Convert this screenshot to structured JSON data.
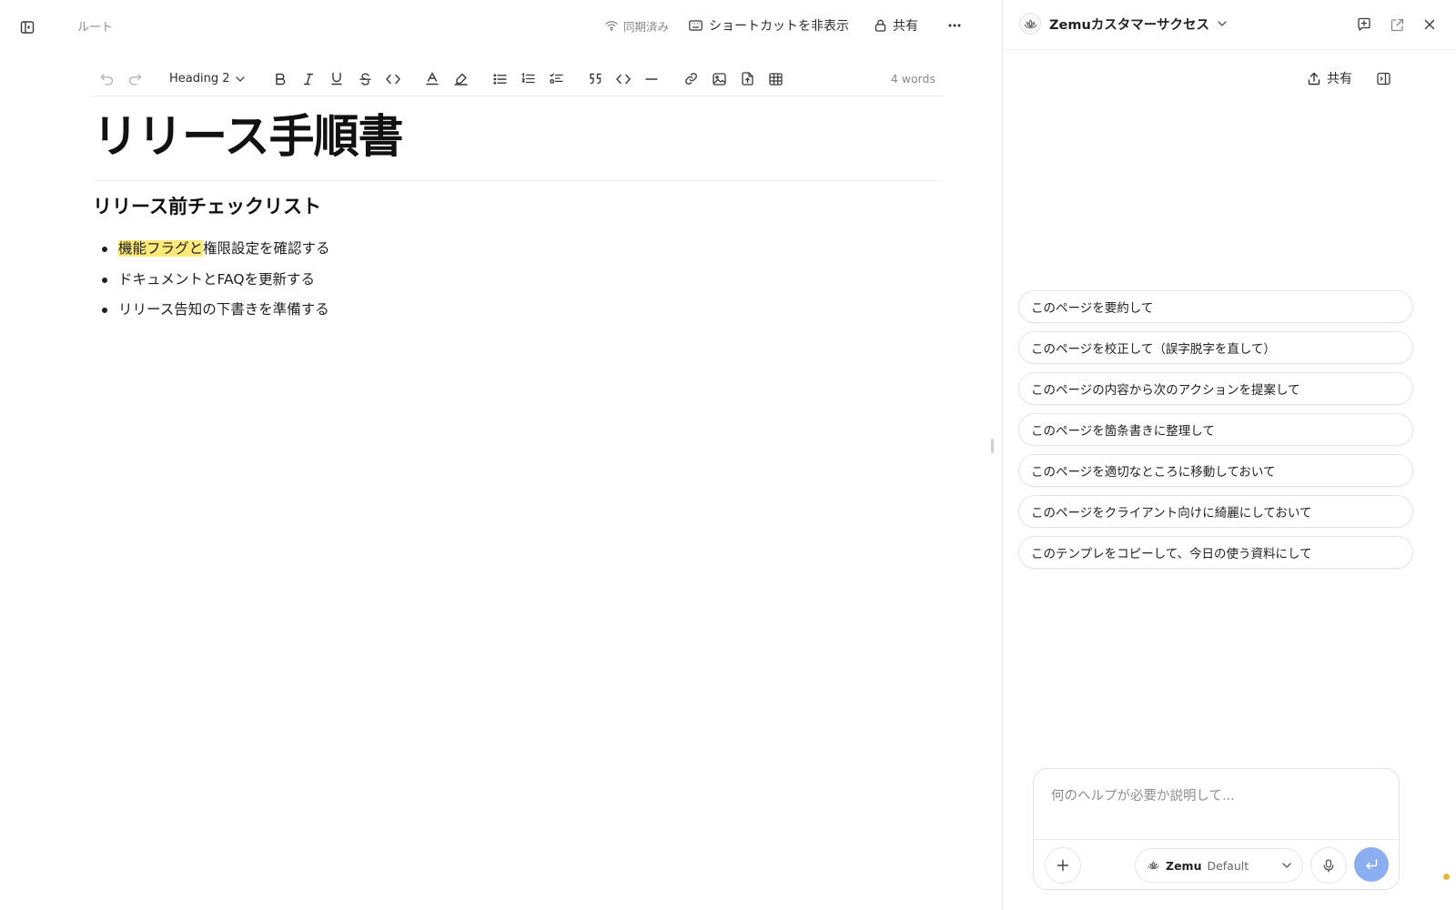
{
  "editor": {
    "breadcrumb": "ルート",
    "sync_status": "同期済み",
    "shortcut_toggle": "ショートカットを非表示",
    "share": "共有",
    "toolbar": {
      "heading_select": "Heading 2",
      "word_count": "4 words"
    },
    "title": "リリース手順書",
    "heading": "リリース前チェックリスト",
    "bullets": [
      {
        "highlight": "機能フラグと",
        "text": "権限設定を確認する"
      },
      {
        "highlight": "",
        "text": "ドキュメントとFAQを更新する"
      },
      {
        "highlight": "",
        "text": "リリース告知の下書きを準備する"
      }
    ]
  },
  "panel": {
    "workspace": "Zemuカスタマーサクセス",
    "share": "共有",
    "suggestions": [
      "このページを要約して",
      "このページを校正して（誤字脱字を直して）",
      "このページの内容から次のアクションを提案して",
      "このページを箇条書きに整理して",
      "このページを適切なところに移動しておいて",
      "このページをクライアント向けに綺麗にしておいて",
      "このテンプレをコピーして、今日の使う資料にして"
    ],
    "composer": {
      "placeholder": "何のヘルプが必要か説明して...",
      "model_name": "Zemu",
      "model_variant": "Default"
    }
  },
  "colors": {
    "highlight": "#fde97a",
    "send_button": "#8aaeef",
    "status_dot": "#e4b73a"
  }
}
